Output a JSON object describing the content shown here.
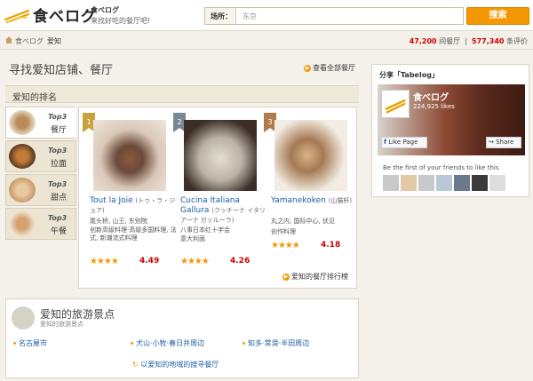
{
  "header": {
    "logo_text": "食べログ",
    "site_name": "食べログ",
    "tagline": "来找好吃的餐厅吧!",
    "search_label": "场所：",
    "search_value": "东京",
    "search_button": "搜索"
  },
  "breadcrumb": {
    "items": [
      "食べログ",
      "爱知"
    ],
    "separator": "›",
    "restaurants_count": "47,200",
    "restaurants_label": "间餐厅",
    "reviews_count": "577,340",
    "reviews_label": "条评价"
  },
  "main": {
    "title": "寻找爱知店铺、餐厅",
    "see_all": "查看全部餐厅",
    "ranking_title": "爱知的排名",
    "tabs": [
      {
        "top": "Top3",
        "label": "餐厅"
      },
      {
        "top": "Top3",
        "label": "拉面"
      },
      {
        "top": "Top3",
        "label": "甜点"
      },
      {
        "top": "Top3",
        "label": "午餐"
      }
    ],
    "cards": [
      {
        "rank": "1",
        "name": "Tout la Joie",
        "name_kana": "(トゥ・ラ・ジョア)",
        "area": "尾头桥, 山王, 东别院",
        "genre": "创新高级料理·高级多国料理, 法式, 新潮流式料理",
        "stars": "★★★★",
        "score": "4.49"
      },
      {
        "rank": "2",
        "name": "Cucina Italiana Gallura",
        "name_kana": "(クッチーナ イタリアーナ ガッルーラ)",
        "area": "八事日本红十字会",
        "genre": "意大利面",
        "stars": "★★★★",
        "score": "4.26"
      },
      {
        "rank": "3",
        "name": "Yamanekoken",
        "name_kana": "(山猫轩)",
        "area": "丸之内, 国际中心, 伏见",
        "genre": "创作料理",
        "stars": "★★★★",
        "score": "4.18"
      }
    ],
    "ranking_more": "爱知的餐厅排行榜",
    "tour_title": "爱知的旅游景点",
    "tour_subtitle": "爱知的旅游景点",
    "tour_links": [
      "名古屋市",
      "犬山·小牧·春日井周边",
      "知多·常滑·半田周边"
    ],
    "tour_more": "以爱知的地域的搜寻餐厅"
  },
  "sidebar": {
    "share_title": "分享「Tabelog」",
    "fb_page_name": "食べログ",
    "fb_likes": "224,925 likes",
    "like_page": "Like Page",
    "share": "Share",
    "friends_text": "Be the first of your friends to like this"
  },
  "colors": {
    "accent": "#f39800",
    "link": "#1c5ea5",
    "score": "#cc0000",
    "background": "#f4f1ea"
  }
}
